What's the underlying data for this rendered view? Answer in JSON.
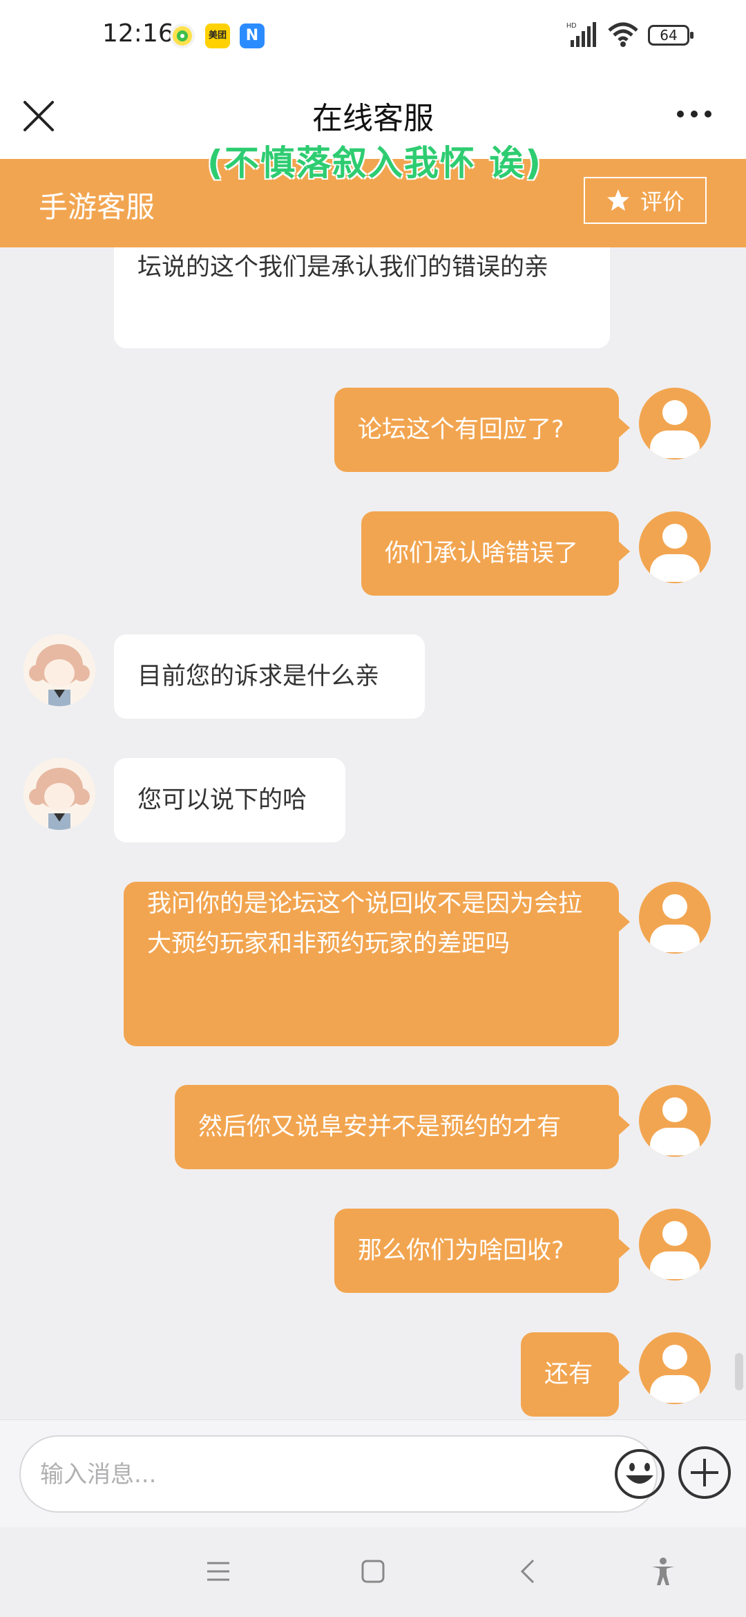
{
  "status_bar": {
    "time": "12:16",
    "meituan_label": "美团",
    "n_app_label": "N",
    "battery": "64"
  },
  "header": {
    "title": "在线客服",
    "watermark": "(不慎落叙入我怀 诶)"
  },
  "service_bar": {
    "title": "手游客服",
    "rate_label": "评价"
  },
  "messages": [
    {
      "side": "agent",
      "text": "坛说的这个我们是承认我们的错误的亲"
    },
    {
      "side": "user",
      "text": "论坛这个有回应了?"
    },
    {
      "side": "user",
      "text": "你们承认啥错误了"
    },
    {
      "side": "agent",
      "text": "目前您的诉求是什么亲"
    },
    {
      "side": "agent",
      "text": "您可以说下的哈"
    },
    {
      "side": "user",
      "text": "我问你的是论坛这个说回收不是因为会拉大预约玩家和非预约玩家的差距吗"
    },
    {
      "side": "user",
      "text": "然后你又说阜安并不是预约的才有"
    },
    {
      "side": "user",
      "text": "那么你们为啥回收?"
    },
    {
      "side": "user",
      "text": "还有"
    }
  ],
  "input": {
    "placeholder": "输入消息..."
  },
  "colors": {
    "accent": "#f2a550",
    "background": "#efeff1",
    "watermark": "#2ecc71"
  },
  "icons": [
    "close-icon",
    "more-icon",
    "star-icon",
    "emoji-icon",
    "plus-icon",
    "menu-icon",
    "home-icon",
    "back-icon",
    "accessibility-icon"
  ]
}
